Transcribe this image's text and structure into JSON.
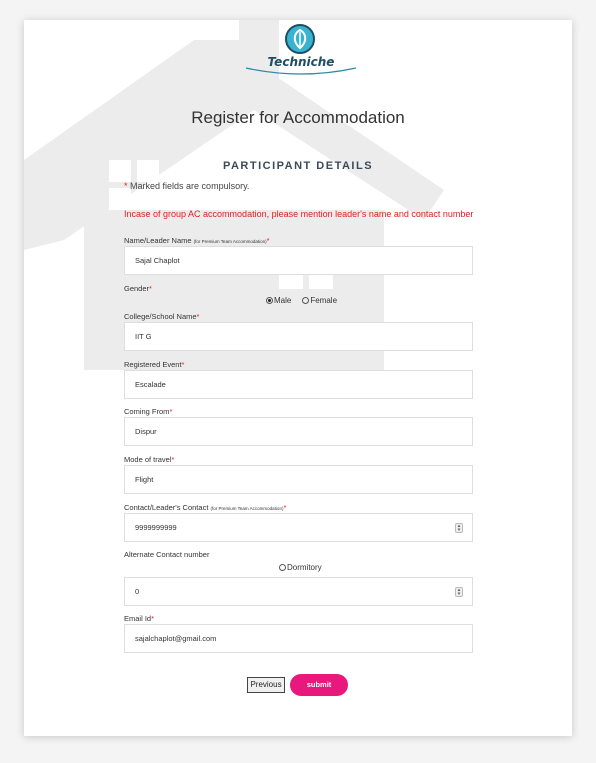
{
  "brand": {
    "name": "Techniche"
  },
  "page": {
    "title": "Register for Accommodation",
    "section_title": "PARTICIPANT DETAILS",
    "compulsory_star": "*",
    "compulsory_note": "Marked fields are compulsory.",
    "group_note": "Incase of group AC accommodation, please mention leader's name and contact number"
  },
  "form": {
    "name": {
      "label": "Name/Leader Name",
      "sub_label": "(for Premium Team Accommodation)",
      "required_mark": "*",
      "value": "Sajal Chaplot"
    },
    "gender": {
      "label": "Gender",
      "required_mark": "*",
      "options": [
        "Male",
        "Female"
      ],
      "selected": "Male"
    },
    "college": {
      "label": "College/School Name",
      "required_mark": "*",
      "value": "IIT G"
    },
    "event": {
      "label": "Registered Event",
      "required_mark": "*",
      "value": "Escalade"
    },
    "coming_from": {
      "label": "Coming From",
      "required_mark": "*",
      "value": "Dispur"
    },
    "travel": {
      "label": "Mode of travel",
      "required_mark": "*",
      "value": "Flight"
    },
    "contact": {
      "label": "Contact/Leader's Contact",
      "sub_label": "(for Premium Team Accommodation)",
      "required_mark": "*",
      "value": "9999999999"
    },
    "alt_contact": {
      "label": "Alternate Contact number"
    },
    "accommodation": {
      "option": "Dormitory",
      "selected": false
    },
    "accommodation_count": {
      "value": "0"
    },
    "email": {
      "label": "Email Id",
      "required_mark": "*",
      "value": "sajalchaplot@gmail.com"
    }
  },
  "actions": {
    "previous": "Previous",
    "submit": "submit"
  },
  "colors": {
    "accent": "#e8187c",
    "required": "#e02020",
    "brand": "#3bb2cf"
  }
}
